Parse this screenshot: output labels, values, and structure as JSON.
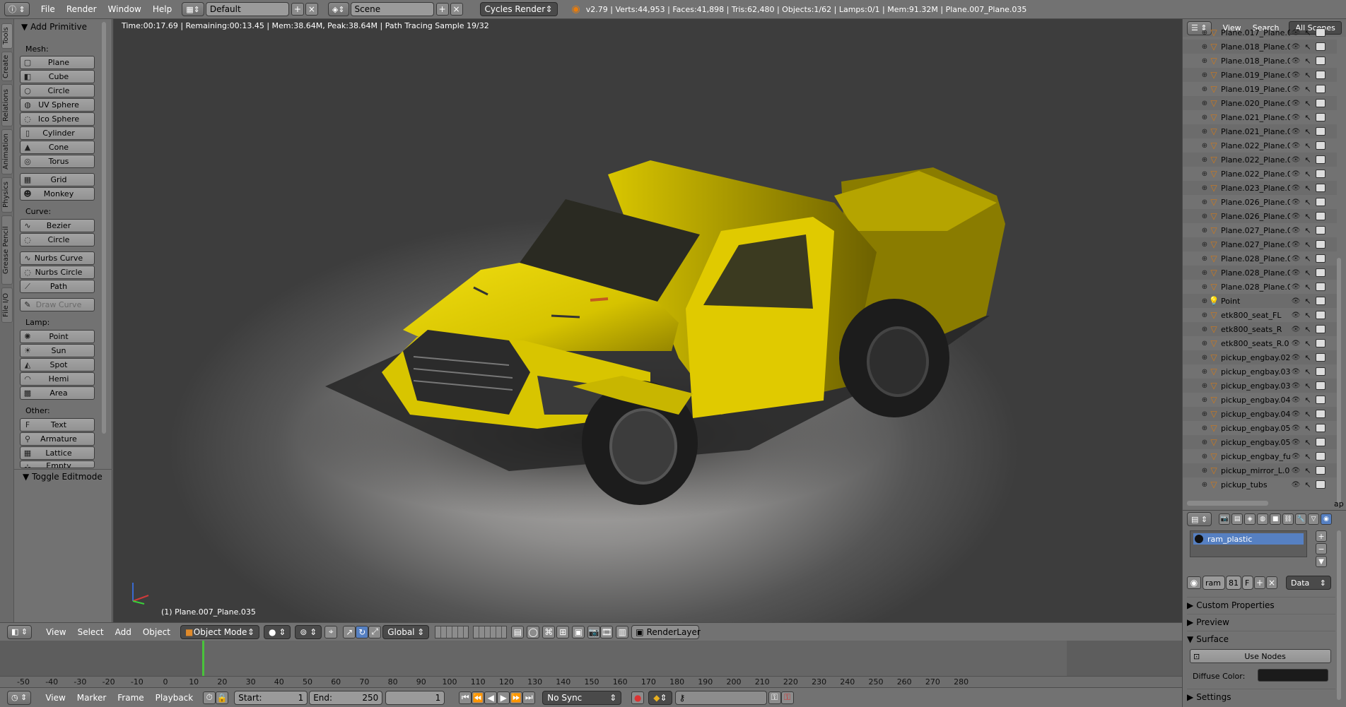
{
  "topbar": {
    "menus": [
      "File",
      "Render",
      "Window",
      "Help"
    ],
    "layout": "Default",
    "scene": "Scene",
    "engine": "Cycles Render",
    "stats": "v2.79 | Verts:44,953 | Faces:41,898 | Tris:62,480 | Objects:1/62 | Lamps:0/1 | Mem:91.32M | Plane.007_Plane.035"
  },
  "left_tabs": [
    "Tools",
    "Create",
    "Relations",
    "Animation",
    "Physics",
    "Grease Pencil",
    "File I/O"
  ],
  "toolshelf": {
    "panel_title": "Add Primitive",
    "mesh_label": "Mesh:",
    "mesh": [
      "Plane",
      "Cube",
      "Circle",
      "UV Sphere",
      "Ico Sphere",
      "Cylinder",
      "Cone",
      "Torus"
    ],
    "mesh2": [
      "Grid",
      "Monkey"
    ],
    "curve_label": "Curve:",
    "curve": [
      "Bezier",
      "Circle"
    ],
    "curve2": [
      "Nurbs Curve",
      "Nurbs Circle",
      "Path"
    ],
    "draw_curve": "Draw Curve",
    "lamp_label": "Lamp:",
    "lamp": [
      "Point",
      "Sun",
      "Spot",
      "Hemi",
      "Area"
    ],
    "other_label": "Other:",
    "other": [
      "Text",
      "Armature",
      "Lattice",
      "Empty"
    ],
    "toggle_editmode": "Toggle Editmode"
  },
  "viewport": {
    "status": "Time:00:17.69 | Remaining:00:13.45 | Mem:38.64M, Peak:38.64M | Path Tracing Sample 19/32",
    "object_label": "(1) Plane.007_Plane.035"
  },
  "view_header": {
    "menus": [
      "View",
      "Select",
      "Add",
      "Object"
    ],
    "mode": "Object Mode",
    "orientation": "Global",
    "render_layer": "RenderLayer"
  },
  "timeline": {
    "ticks": [
      "-50",
      "-40",
      "-30",
      "-20",
      "-10",
      "0",
      "10",
      "20",
      "30",
      "40",
      "50",
      "60",
      "70",
      "80",
      "90",
      "100",
      "110",
      "120",
      "130",
      "140",
      "150",
      "160",
      "170",
      "180",
      "190",
      "200",
      "210",
      "220",
      "230",
      "240",
      "250",
      "260",
      "270",
      "280"
    ]
  },
  "bottom_header": {
    "menus": [
      "View",
      "Marker",
      "Frame",
      "Playback"
    ],
    "start_label": "Start:",
    "start_value": "1",
    "end_label": "End:",
    "end_value": "250",
    "current_frame": "1",
    "sync": "No Sync"
  },
  "outliner": {
    "header_menus": [
      "View",
      "Search"
    ],
    "scenes": "All Scenes",
    "items": [
      "Plane.017_Plane.0",
      "Plane.018_Plane.0",
      "Plane.018_Plane.0",
      "Plane.019_Plane.0",
      "Plane.019_Plane.0",
      "Plane.020_Plane.0",
      "Plane.021_Plane.0",
      "Plane.021_Plane.0",
      "Plane.022_Plane.0",
      "Plane.022_Plane.0",
      "Plane.022_Plane.0",
      "Plane.023_Plane.0",
      "Plane.026_Plane.0",
      "Plane.026_Plane.0",
      "Plane.027_Plane.0",
      "Plane.027_Plane.0",
      "Plane.028_Plane.0",
      "Plane.028_Plane.0",
      "Plane.028_Plane.0",
      "Point",
      "etk800_seat_FL",
      "etk800_seats_R",
      "etk800_seats_R.0",
      "pickup_engbay.02",
      "pickup_engbay.03",
      "pickup_engbay.03",
      "pickup_engbay.04",
      "pickup_engbay.04",
      "pickup_engbay.05",
      "pickup_engbay.05",
      "pickup_engbay_ful",
      "pickup_mirror_L.0",
      "pickup_tubs"
    ],
    "overflow_text": "ap"
  },
  "properties": {
    "material": "ram_plastic",
    "mat_name_short": "ram",
    "users": "81",
    "fake": "F",
    "link": "Data",
    "sections": [
      "Custom Properties",
      "Preview",
      "Surface",
      "Settings"
    ],
    "use_nodes": "Use Nodes",
    "diffuse_label": "Diffuse Color:"
  },
  "colors": {
    "accent_blue": "#5680c2",
    "truck_yellow": "#e2cf00",
    "playhead": "#49c33b"
  }
}
